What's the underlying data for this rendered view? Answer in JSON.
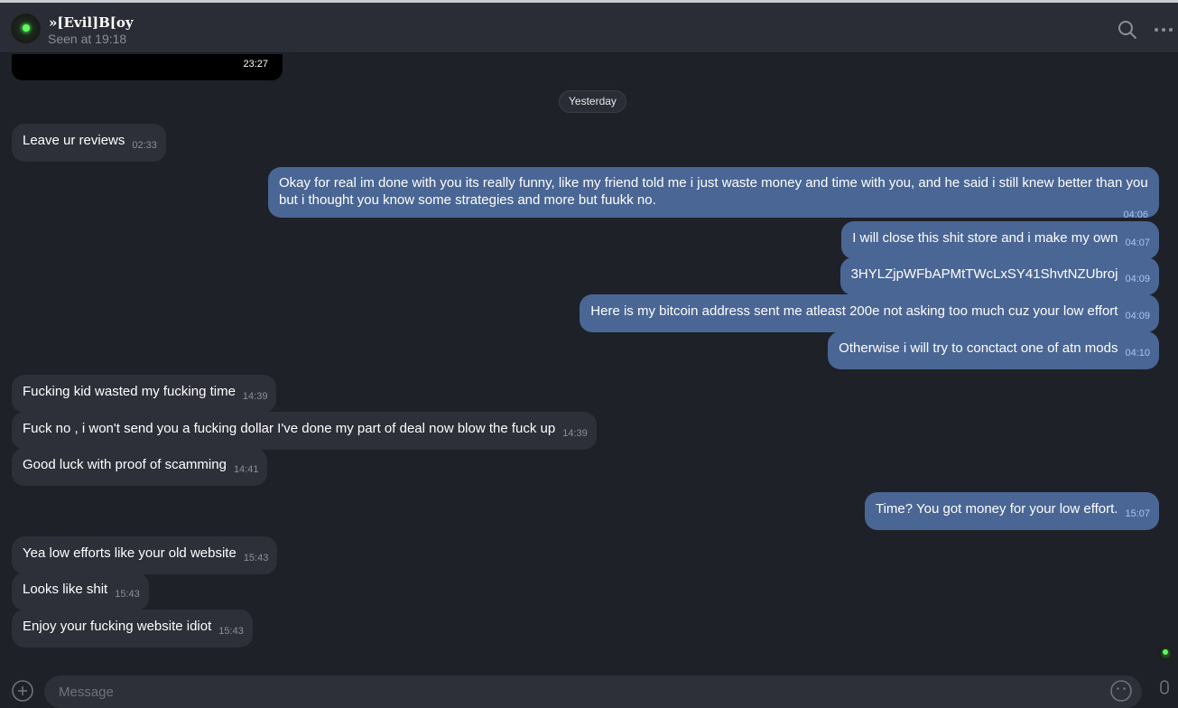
{
  "header": {
    "chat_name": "»[Evil]B[oy",
    "status": "Seen at 19:18",
    "search_icon": "search-icon",
    "more_icon": "more-horizontal-icon"
  },
  "media": {
    "time": "23:27"
  },
  "date_separator": "Yesterday",
  "messages": [
    {
      "text": "Leave ur reviews",
      "time": "02:33"
    },
    {
      "text": "Okay for real im done with you its really funny, like my friend told me i just waste money and time with you, and he said i still knew better than you but i thought you know some strategies and more but fuukk no.",
      "time": "04:06"
    },
    {
      "text": "I will close this shit store and i make my own",
      "time": "04:07"
    },
    {
      "text": "3HYLZjpWFbAPMtTWcLxSY41ShvtNZUbroj",
      "time": "04:09"
    },
    {
      "text": "Here is my bitcoin address sent me atleast 200e not asking too much cuz your low effort",
      "time": "04:09"
    },
    {
      "text": "Otherwise i will try to conctact one of atn mods",
      "time": "04:10"
    },
    {
      "text": "Fucking kid wasted my fucking time",
      "time": "14:39"
    },
    {
      "text": "Fuck no , i won't send you a fucking dollar I've done my part of deal now blow the fuck up",
      "time": "14:39"
    },
    {
      "text": "Good luck with proof of scamming",
      "time": "14:41"
    },
    {
      "text": "Time? You got money for your low effort.",
      "time": "15:07"
    },
    {
      "text": "Yea low efforts like your old website",
      "time": "15:43"
    },
    {
      "text": "Looks like shit",
      "time": "15:43"
    },
    {
      "text": "Enjoy your fucking website idiot",
      "time": "15:43"
    }
  ],
  "composer": {
    "placeholder": "Message",
    "attach_icon": "attach-icon",
    "emoji_icon": "emoji-icon",
    "mic_icon": "microphone-icon"
  },
  "colors": {
    "background": "#1f2129",
    "header": "#2a2d35",
    "incoming_bubble": "#2d3039",
    "outgoing_bubble": "#4a6694",
    "incoming_time": "#8b8f97",
    "outgoing_time": "#a9c4ef"
  }
}
